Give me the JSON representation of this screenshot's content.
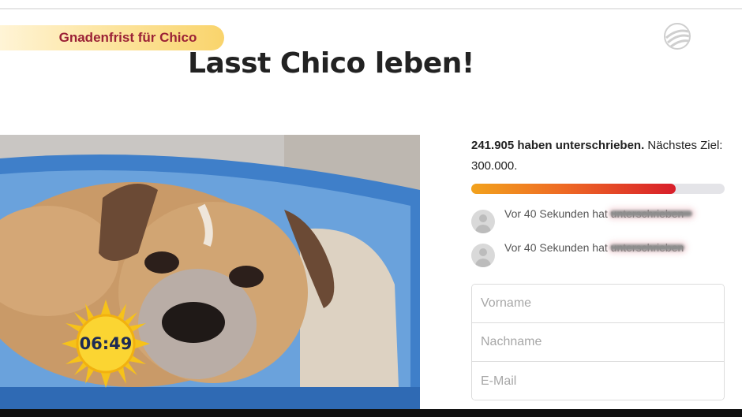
{
  "banner": {
    "text": "Gnadenfrist für Chico"
  },
  "headline": "Lasst Chico leben!",
  "overlay": {
    "clock": "06:49"
  },
  "petition": {
    "signed_count_text": "241.905 haben unterschrieben.",
    "goal_text": " Nächstes Ziel: 300.000.",
    "progress_fraction": 0.806
  },
  "recent_signers": [
    {
      "text": "Vor 40 Sekunden hat unterschrieben"
    },
    {
      "text": "Vor 40 Sekunden hat unterschrieben"
    }
  ],
  "form": {
    "first_name_placeholder": "Vorname",
    "last_name_placeholder": "Nachname",
    "email_placeholder": "E-Mail"
  },
  "colors": {
    "banner_text": "#9b2136",
    "progress_start": "#f2a21d",
    "progress_end": "#d81e2a",
    "clock_text": "#1e2b54"
  },
  "icons": [
    "sat1-ball-logo-icon",
    "sun-icon",
    "avatar-icon"
  ]
}
